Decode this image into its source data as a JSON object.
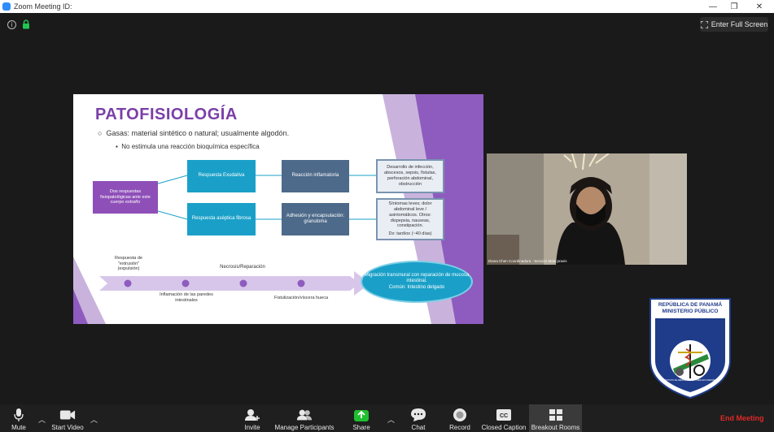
{
  "window": {
    "title": "Zoom Meeting ID:"
  },
  "top": {
    "fullscreen_label": "Enter Full Screen"
  },
  "slide": {
    "title": "PATOFISIOLOGÍA",
    "bullet1": "Gasas: material sintético o natural; usualmente algodón.",
    "bullet2": "No estimula una reacción bioquímica específica",
    "root": "Dos respuestas fisiopatológicas ante este cuerpo extraño",
    "resp1": "Respuesta Exudativa",
    "resp2": "Respuesta aséptica fibrosa",
    "mid1": "Reacción inflamatoria",
    "mid2": "Adhesión y encapsulación: granuloma",
    "out1": "Desarrollo de infección, abscesos, sepsis, fístulas, perforación abdominal, obstrucción",
    "out2a": "Síntomas leves; dolor abdominal leve / asintomáticos. Otros: dispepsia, nauseas, constipación.",
    "out2b": "Dx: tardíos (~40 días)",
    "tl1": "Respuesta de \"extrusión\" (expulsión)",
    "tl2": "Inflamación de las paredes intestinales",
    "tl3": "Necrosis/Reparación",
    "tl4": "Fistulización/víscera hueca",
    "final1": "Migración transmural con reparación de mucosa intestinal.",
    "final2": "Común: Intestino delgado"
  },
  "video": {
    "participant_label": "Diana Chen Coordinadora - Sección Mala praxis"
  },
  "logo": {
    "line1": "REPÚBLICA DE PANAMÁ",
    "line2": "MINISTERIO PÚBLICO",
    "ring": "INSTITUTO DE MEDICINA LEGAL Y CIENCIAS FORENSES"
  },
  "toolbar": {
    "mute": "Mute",
    "start_video": "Start Video",
    "invite": "Invite",
    "manage_participants": "Manage Participants",
    "share": "Share",
    "chat": "Chat",
    "record": "Record",
    "closed_caption": "Closed Caption",
    "breakout_rooms": "Breakout Rooms",
    "end_meeting": "End Meeting"
  },
  "colors": {
    "share_green": "#1fbf2f",
    "end_red": "#e02828",
    "slide_purple": "#7b3fa8",
    "box_teal": "#1aa0c8",
    "box_slate": "#4e6a8a"
  }
}
